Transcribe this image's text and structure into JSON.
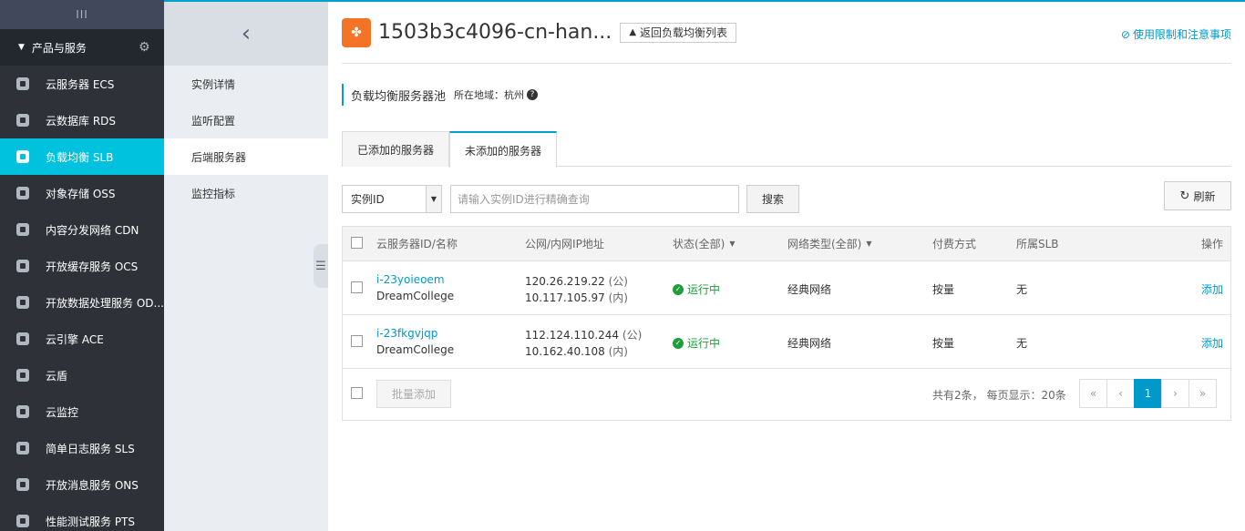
{
  "sidebar": {
    "toggle_label": "III",
    "group_label": "产品与服务",
    "items": [
      {
        "label": "云服务器 ECS"
      },
      {
        "label": "云数据库 RDS"
      },
      {
        "label": "负载均衡 SLB"
      },
      {
        "label": "对象存储 OSS"
      },
      {
        "label": "内容分发网络 CDN"
      },
      {
        "label": "开放缓存服务 OCS"
      },
      {
        "label": "开放数据处理服务 OD..."
      },
      {
        "label": "云引擎 ACE"
      },
      {
        "label": "云盾"
      },
      {
        "label": "云监控"
      },
      {
        "label": "简单日志服务 SLS"
      },
      {
        "label": "开放消息服务 ONS"
      },
      {
        "label": "性能测试服务 PTS"
      }
    ]
  },
  "subnav": {
    "items": [
      {
        "label": "实例详情"
      },
      {
        "label": "监听配置"
      },
      {
        "label": "后端服务器"
      },
      {
        "label": "监控指标"
      }
    ]
  },
  "header": {
    "title": "1503b3c4096-cn-han...",
    "back_label": "返回负载均衡列表",
    "limits_label": "使用限制和注意事项"
  },
  "section": {
    "title": "负载均衡服务器池",
    "region": "所在地域：杭州"
  },
  "tabs": [
    {
      "label": "已添加的服务器"
    },
    {
      "label": "未添加的服务器"
    }
  ],
  "toolbar": {
    "select_value": "实例ID",
    "search_placeholder": "请输入实例ID进行精确查询",
    "search_label": "搜索",
    "refresh_label": "刷新"
  },
  "table": {
    "headers": {
      "id": "云服务器ID/名称",
      "ip": "公网/内网IP地址",
      "status": "状态(全部)",
      "network": "网络类型(全部)",
      "billing": "付费方式",
      "slb": "所属SLB",
      "action": "操作"
    },
    "rows": [
      {
        "id": "i-23yoieoem",
        "name": "DreamCollege",
        "public_ip": "120.26.219.22",
        "public_tag": "(公)",
        "private_ip": "10.117.105.97",
        "private_tag": "(内)",
        "status": "运行中",
        "network": "经典网络",
        "billing": "按量",
        "slb": "无",
        "action": "添加"
      },
      {
        "id": "i-23fkgvjqp",
        "name": "DreamCollege",
        "public_ip": "112.124.110.244",
        "public_tag": "(公)",
        "private_ip": "10.162.40.108",
        "private_tag": "(内)",
        "status": "运行中",
        "network": "经典网络",
        "billing": "按量",
        "slb": "无",
        "action": "添加"
      }
    ],
    "batch_label": "批量添加",
    "page_info": "共有2条， 每页显示：20条",
    "pager": {
      "first": "«",
      "prev": "‹",
      "current": "1",
      "next": "›",
      "last": "»"
    }
  }
}
